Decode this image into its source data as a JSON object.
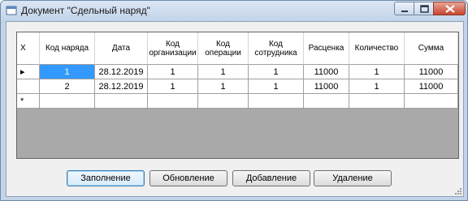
{
  "window": {
    "title": "Документ \"Сдельный наряд\""
  },
  "grid": {
    "columns": [
      "X",
      "Код наряда",
      "Дата",
      "Код организации",
      "Код операции",
      "Код сотрудника",
      "Расценка",
      "Количество",
      "Сумма"
    ],
    "rows": [
      {
        "marker": "▸",
        "cells": [
          "1",
          "28.12.2019",
          "1",
          "1",
          "1",
          "11000",
          "1",
          "11000"
        ]
      },
      {
        "marker": "",
        "cells": [
          "2",
          "28.12.2019",
          "1",
          "1",
          "1",
          "11000",
          "1",
          "11000"
        ]
      }
    ],
    "new_row_marker": "*"
  },
  "buttons": {
    "fill": "Заполнение",
    "refresh": "Обновление",
    "add": "Добавление",
    "delete": "Удаление"
  }
}
